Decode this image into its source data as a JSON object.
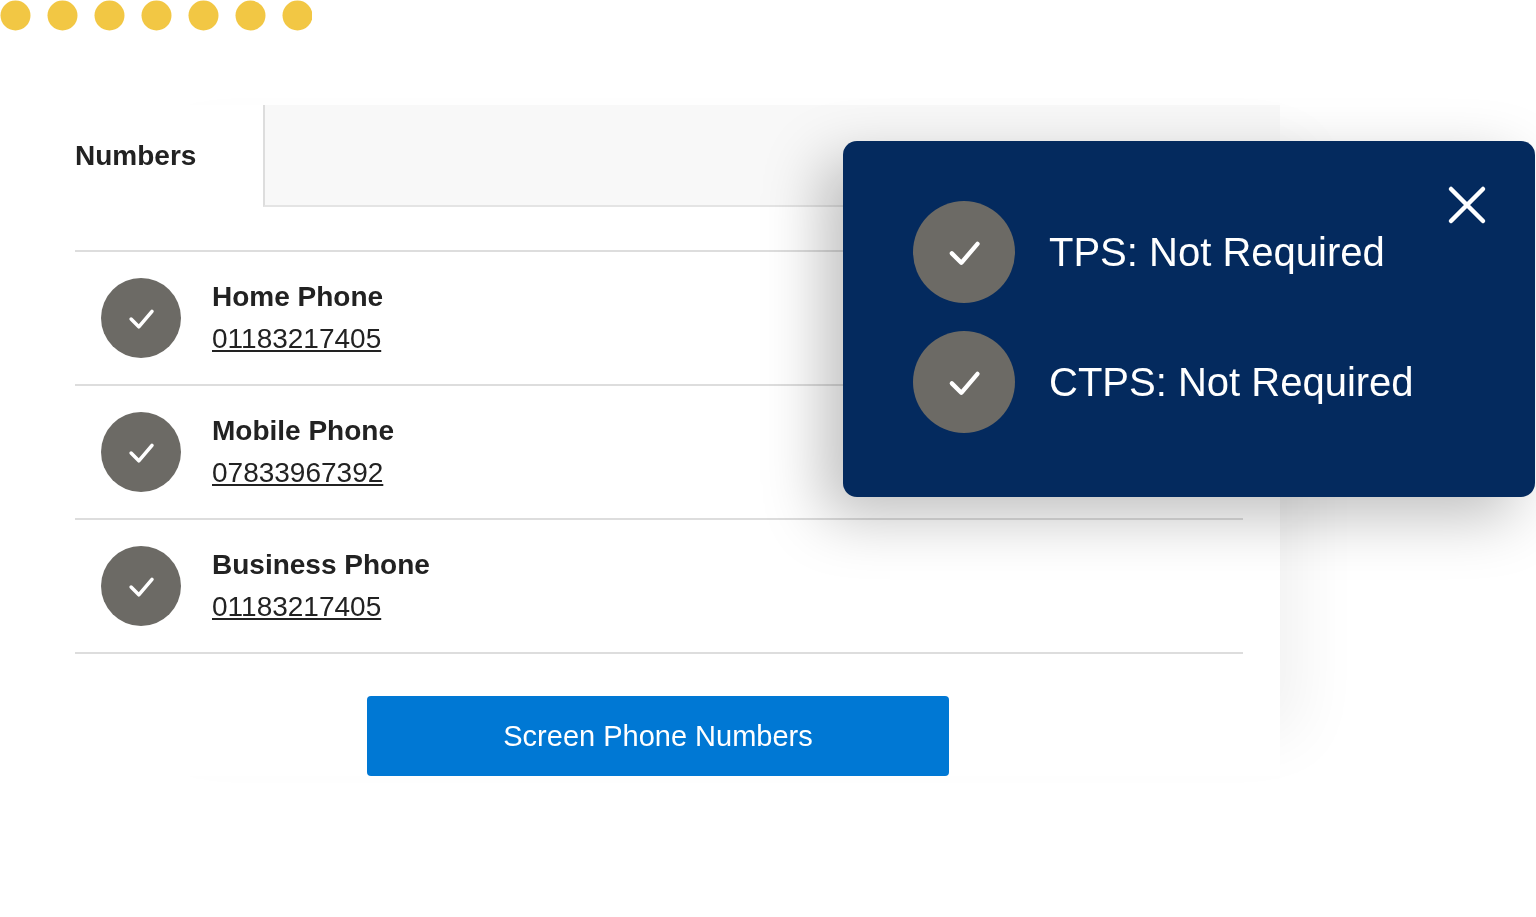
{
  "form": {
    "label": "Numbers"
  },
  "phones": [
    {
      "name": "Home Phone",
      "number": "01183217405",
      "checked": true
    },
    {
      "name": "Mobile Phone",
      "number": "07833967392",
      "checked": true
    },
    {
      "name": "Business Phone",
      "number": "01183217405",
      "checked": true
    }
  ],
  "button": "Screen Phone Numbers",
  "popup": {
    "results": [
      {
        "text": "TPS: Not Required",
        "checked": true
      },
      {
        "text": "CTPS: Not Required",
        "checked": true
      }
    ]
  }
}
